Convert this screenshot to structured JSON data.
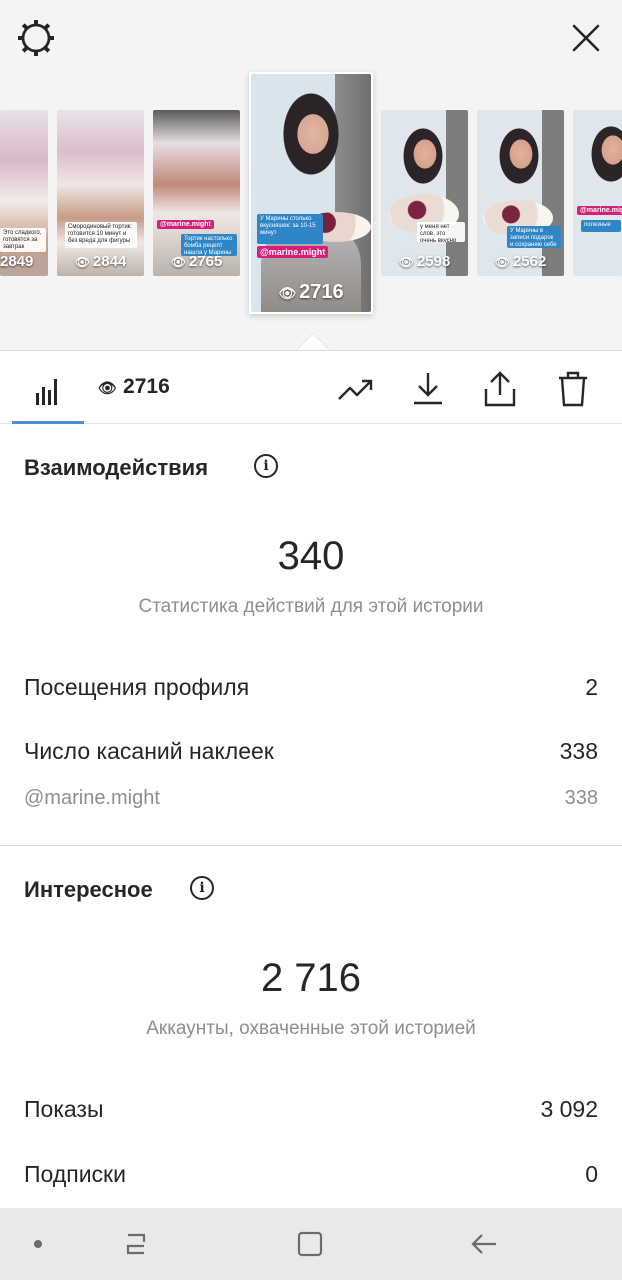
{
  "header": {
    "settings_icon": "gear-icon",
    "close_icon": "close-icon"
  },
  "stories": [
    {
      "views": "2849",
      "caption": "Это сладкого, готовятся за завтрак",
      "tag": ""
    },
    {
      "views": "2844",
      "caption": "Смородиновый тортик: готовится 10 минут и без вреда для фигуры",
      "tag": ""
    },
    {
      "views": "2765",
      "caption": "Тортик настолько бомба рецепт нашла у Марины",
      "tag": "@marine.might"
    },
    {
      "views": "2716",
      "caption": "У Марины столько вкусняшек: за 10-15 минут",
      "tag": "@marine.might"
    },
    {
      "views": "2598",
      "caption": "у меня нет слов, это очень вкусно",
      "tag": ""
    },
    {
      "views": "2562",
      "caption": "У Марины в записи подарок и сохраняю себе очень нравится",
      "tag": ""
    },
    {
      "views": "",
      "caption": "полезные",
      "tag": "@marine.might"
    }
  ],
  "toolbar": {
    "views": "2716",
    "icons": [
      "bar-chart-icon",
      "eye-icon",
      "trending-icon",
      "download-icon",
      "share-icon",
      "trash-icon"
    ]
  },
  "interactions": {
    "title": "Взаимодействия",
    "total": "340",
    "subtitle": "Статистика действий для этой истории",
    "rows": [
      {
        "label": "Посещения профиля",
        "value": "2"
      },
      {
        "label": "Число касаний наклеек",
        "value": "338"
      },
      {
        "label": "@marine.might",
        "value": "338"
      }
    ]
  },
  "discovery": {
    "title": "Интересное",
    "total": "2 716",
    "subtitle": "Аккаунты, охваченные этой историей",
    "rows": [
      {
        "label": "Показы",
        "value": "3 092"
      },
      {
        "label": "Подписки",
        "value": "0"
      }
    ]
  },
  "navbar": {
    "icons": [
      "dot-icon",
      "recent-apps-icon",
      "home-icon",
      "back-icon"
    ]
  }
}
